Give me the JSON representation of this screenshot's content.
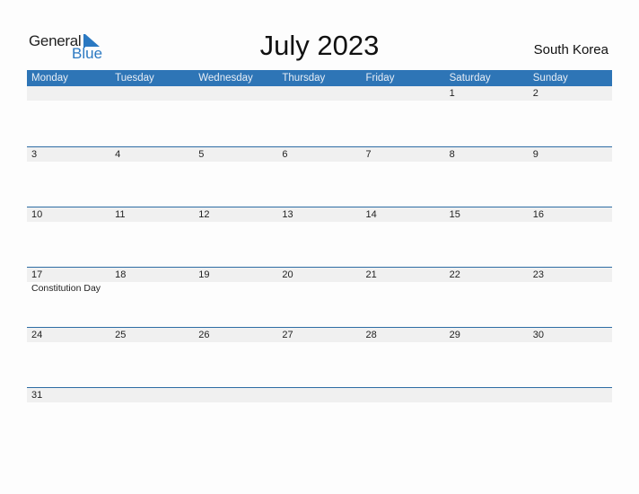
{
  "logo": {
    "line1": "General",
    "line2": "Blue"
  },
  "title": "July 2023",
  "country": "South Korea",
  "colors": {
    "header": "#2e75b6",
    "accent": "#2b79c2",
    "strip": "#f0f0f0"
  },
  "weekdays": [
    "Monday",
    "Tuesday",
    "Wednesday",
    "Thursday",
    "Friday",
    "Saturday",
    "Sunday"
  ],
  "weeks": [
    {
      "days": [
        "",
        "",
        "",
        "",
        "",
        "1",
        "2"
      ],
      "events": [
        "",
        "",
        "",
        "",
        "",
        "",
        ""
      ]
    },
    {
      "days": [
        "3",
        "4",
        "5",
        "6",
        "7",
        "8",
        "9"
      ],
      "events": [
        "",
        "",
        "",
        "",
        "",
        "",
        ""
      ]
    },
    {
      "days": [
        "10",
        "11",
        "12",
        "13",
        "14",
        "15",
        "16"
      ],
      "events": [
        "",
        "",
        "",
        "",
        "",
        "",
        ""
      ]
    },
    {
      "days": [
        "17",
        "18",
        "19",
        "20",
        "21",
        "22",
        "23"
      ],
      "events": [
        "Constitution Day",
        "",
        "",
        "",
        "",
        "",
        ""
      ]
    },
    {
      "days": [
        "24",
        "25",
        "26",
        "27",
        "28",
        "29",
        "30"
      ],
      "events": [
        "",
        "",
        "",
        "",
        "",
        "",
        ""
      ]
    },
    {
      "days": [
        "31",
        "",
        "",
        "",
        "",
        "",
        ""
      ],
      "events": [
        "",
        "",
        "",
        "",
        "",
        "",
        ""
      ]
    }
  ]
}
